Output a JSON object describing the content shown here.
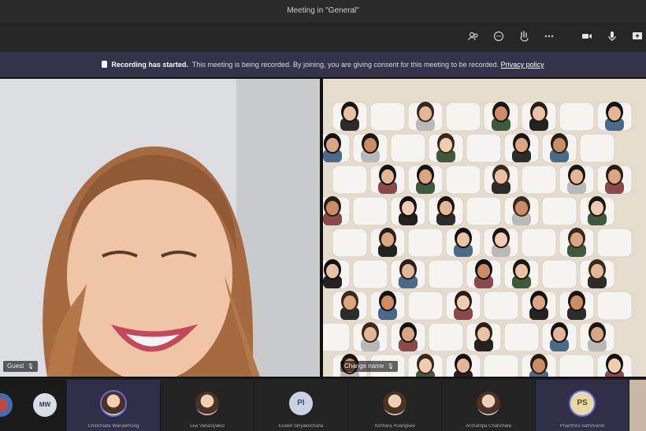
{
  "window": {
    "title": "Meeting in \"General\""
  },
  "toolbar": {
    "icons": [
      "people-icon",
      "chat-icon",
      "reactions-icon",
      "more-icon",
      "camera-icon",
      "mic-icon",
      "share-icon"
    ]
  },
  "banner": {
    "title": "Recording has started.",
    "text": "This meeting is being recorded. By joining, you are giving consent for this meeting to be recorded.",
    "link": "Privacy policy"
  },
  "stage": {
    "left_label": "Guest",
    "right_label": "Change name"
  },
  "participants": [
    {
      "initials": "",
      "name": ""
    },
    {
      "initials": "MW",
      "name": ""
    },
    {
      "initials": "",
      "name": "Chatchada Wanaerhong"
    },
    {
      "initials": "",
      "name": "Lea Vanasiyakul"
    },
    {
      "initials": "PI",
      "name": "Ekawit Siriyakochana"
    },
    {
      "initials": "",
      "name": "Achhara Ruangsee"
    },
    {
      "initials": "",
      "name": "Archampa Chanchala"
    },
    {
      "initials": "PS",
      "name": "Phanthira Sathitvanid"
    }
  ],
  "colors": {
    "banner_bg": "#33344a",
    "accent": "#6b6fd6"
  }
}
